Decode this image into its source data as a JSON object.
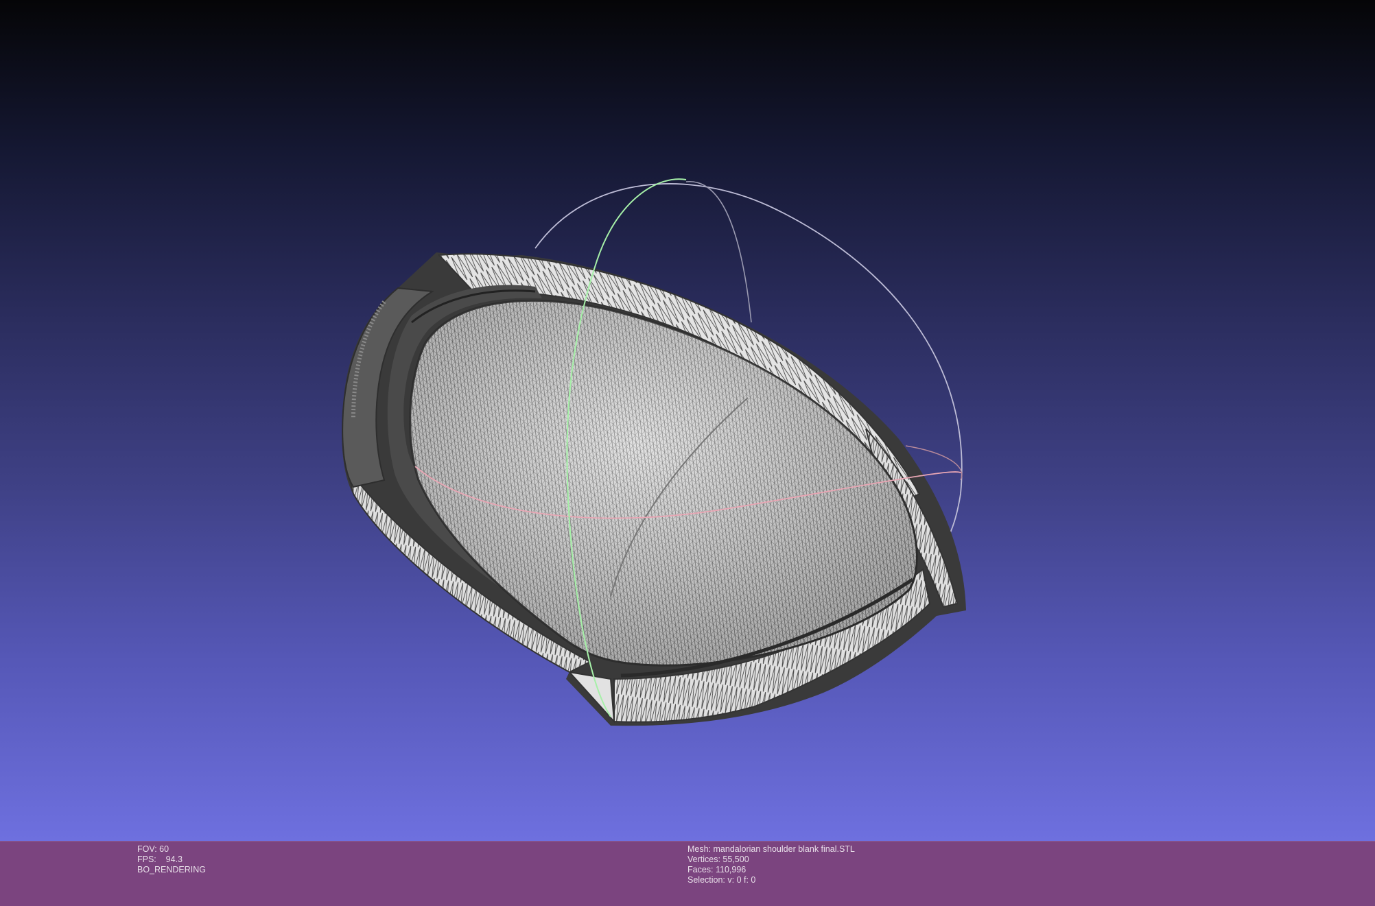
{
  "viewer": {
    "background_top": "#050507",
    "background_bottom": "#6e70df",
    "mesh_wire_color": "#3f3f3f",
    "mesh_face_color": "#e6e6e6",
    "trackball_colors": {
      "x": "#e8a6b4",
      "y": "#a6f0a8",
      "z": "#c8c8d8"
    }
  },
  "info_bar": {
    "background": "#7b447f",
    "fov": "FOV: 60",
    "fps": "FPS:    94.3",
    "render_mode": "BO_RENDERING",
    "mesh": "Mesh: mandalorian shoulder blank final.STL",
    "vertices": "Vertices: 55,500",
    "faces": "Faces: 110,996",
    "selection": "Selection: v: 0 f: 0"
  }
}
